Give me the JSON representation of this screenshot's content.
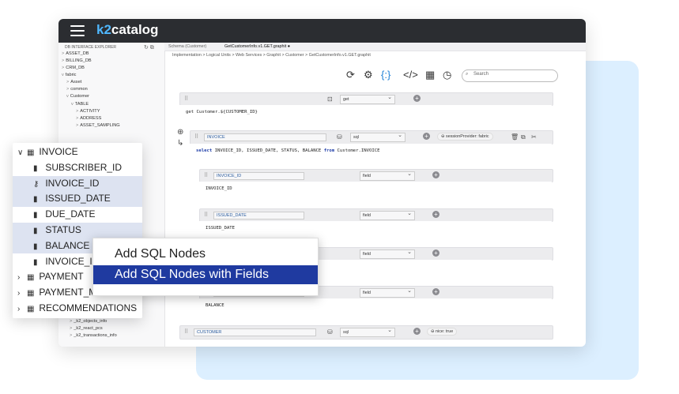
{
  "app": {
    "logo_k2": "k2",
    "logo_rest": "catalog"
  },
  "sidebar": {
    "header": "DB INTERFACE EXPLORER",
    "items": [
      {
        "label": "ASSET_DB",
        "chev": ">"
      },
      {
        "label": "BILLING_DB",
        "chev": ">"
      },
      {
        "label": "CRM_DB",
        "chev": ">"
      },
      {
        "label": "fabric",
        "chev": "v"
      },
      {
        "label": "Asset",
        "chev": ">"
      },
      {
        "label": "common",
        "chev": ">"
      },
      {
        "label": "Customer",
        "chev": "v"
      },
      {
        "label": "TABLE",
        "chev": "v"
      },
      {
        "label": "ACTIVITY",
        "chev": ">"
      },
      {
        "label": "ADDRESS",
        "chev": ">"
      },
      {
        "label": "ASSET_SAMPLING",
        "chev": ">"
      }
    ],
    "bottom_items": [
      {
        "label": "_k2_objects_info",
        "chev": ">"
      },
      {
        "label": "_k2_react_pcs",
        "chev": ">"
      },
      {
        "label": "_k2_transactions_info",
        "chev": ">"
      }
    ]
  },
  "tabs": [
    {
      "label": "Schema (Customer)"
    },
    {
      "label": "GetCustomerInfo.v1.GET.graphit"
    }
  ],
  "breadcrumb": "Implementation  >  Logical Units  >  Web Services  >  Graphit  >  Customer  >  GetCustomerInfo.v1.GET.graphit",
  "toolbar": {
    "search_placeholder": "Search",
    "icons": [
      "refresh-icon",
      "settings-icon",
      "json-icon",
      "code-icon",
      "table-icon",
      "history-icon"
    ]
  },
  "nodes": {
    "root": {
      "select": "get",
      "body": "get Customer.${CUSTOMER_ID}"
    },
    "invoice": {
      "name": "INVOICE",
      "select": "sql",
      "badge": "sessionProvider: fabric",
      "sql_select": "select",
      "sql_fields": "INVOICE_ID, ISSUED_DATE, STATUS, BALANCE",
      "sql_from": "from",
      "sql_table": "Customer.INVOICE"
    },
    "fields": [
      {
        "name": "INVOICE_ID",
        "select": "field",
        "body": "INVOICE_ID"
      },
      {
        "name": "ISSUED_DATE",
        "select": "field",
        "body": "ISSUED_DATE"
      },
      {
        "name": "",
        "select": "field",
        "body": ""
      },
      {
        "name": "",
        "select": "field",
        "body": "BALANCE"
      }
    ],
    "customer": {
      "name": "CUSTOMER",
      "select": "sql",
      "badge": "nice: true"
    }
  },
  "tree_popup": {
    "rows": [
      {
        "label": "INVOICE",
        "chev": "v",
        "icon": "table-icon",
        "indent": 0,
        "highlight": false
      },
      {
        "label": "SUBSCRIBER_ID",
        "chev": "",
        "icon": "column-icon",
        "indent": 1,
        "highlight": false
      },
      {
        "label": "INVOICE_ID",
        "chev": "",
        "icon": "key-icon",
        "indent": 1,
        "highlight": true
      },
      {
        "label": "ISSUED_DATE",
        "chev": "",
        "icon": "column-icon",
        "indent": 1,
        "highlight": true
      },
      {
        "label": "DUE_DATE",
        "chev": "",
        "icon": "column-icon",
        "indent": 1,
        "highlight": false
      },
      {
        "label": "STATUS",
        "chev": "",
        "icon": "column-icon",
        "indent": 1,
        "highlight": true
      },
      {
        "label": "BALANCE",
        "chev": "",
        "icon": "column-icon",
        "indent": 1,
        "highlight": true
      },
      {
        "label": "INVOICE_IM",
        "chev": "",
        "icon": "column-icon",
        "indent": 1,
        "highlight": false
      },
      {
        "label": "PAYMENT",
        "chev": ">",
        "icon": "table-icon",
        "indent": 0,
        "highlight": false
      },
      {
        "label": "PAYMENT_M",
        "chev": ">",
        "icon": "table-icon",
        "indent": 0,
        "highlight": false
      },
      {
        "label": "RECOMMENDATIONS",
        "chev": ">",
        "icon": "table-icon",
        "indent": 0,
        "highlight": false
      }
    ]
  },
  "context_menu": {
    "items": [
      {
        "label": "Add SQL Nodes",
        "active": false
      },
      {
        "label": "Add SQL Nodes with Fields",
        "active": true
      }
    ]
  }
}
